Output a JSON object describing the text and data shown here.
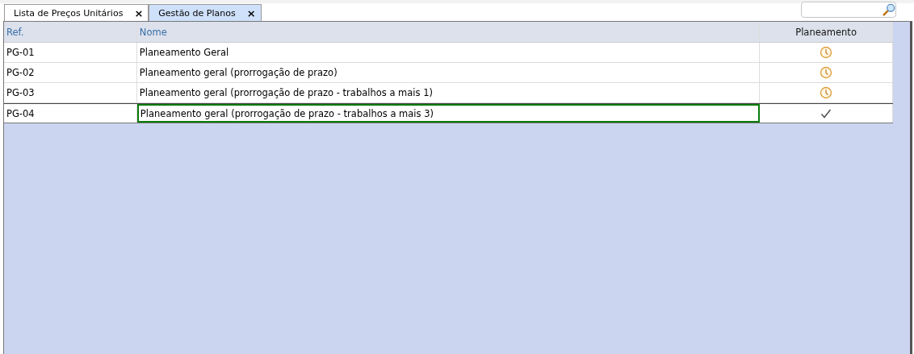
{
  "tabs": [
    {
      "label": "Lista de Preços Unitários",
      "close": "×",
      "selected": false
    },
    {
      "label": "Gestão de Planos",
      "close": "×",
      "selected": true
    }
  ],
  "table": {
    "columns": [
      "Ref.",
      "Nome",
      "Planeamento"
    ],
    "rows": [
      {
        "ref": "PG-01",
        "name": "Planeamento Geral",
        "kind": "pending",
        "selected": false
      },
      {
        "ref": "PG-02",
        "name": "Planeamento geral (prorrogação de prazo)",
        "kind": "pending",
        "selected": false
      },
      {
        "ref": "PG-03",
        "name": "Planeamento geral (prorrogação de prazo - trabalhos a mais 1)",
        "kind": "pending",
        "selected": false
      },
      {
        "ref": "PG-04",
        "name": "Planeamento geral (prorrogação de prazo - trabalhos a mais 3)",
        "kind": "done",
        "selected": true
      }
    ]
  }
}
